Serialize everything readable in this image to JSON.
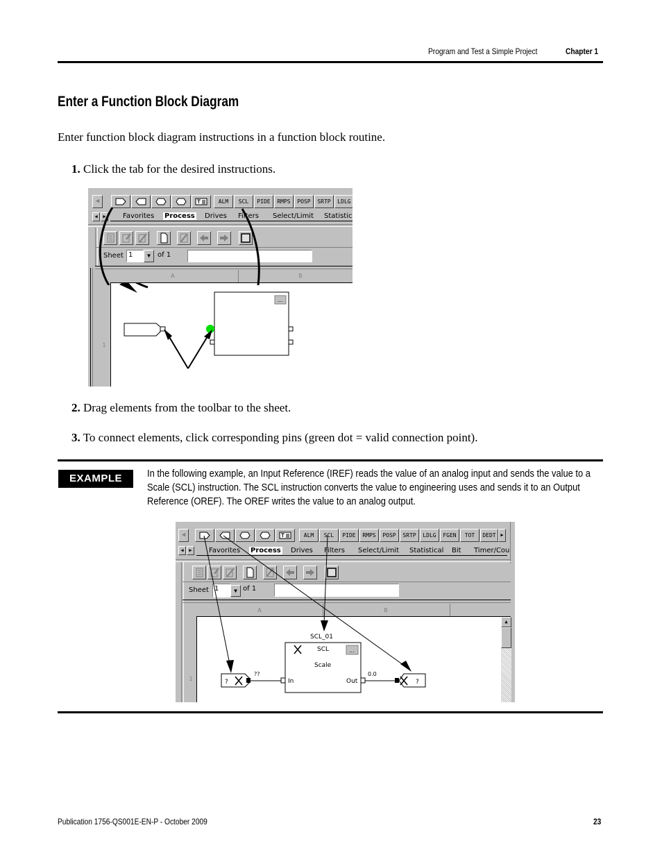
{
  "header": {
    "section_title": "Program and Test a Simple Project",
    "chapter": "Chapter 1"
  },
  "main": {
    "heading": "Enter a Function Block Diagram",
    "intro": "Enter function block diagram instructions in a function block routine.",
    "steps": [
      {
        "num": "1.",
        "text": "Click the tab for the desired instructions."
      },
      {
        "num": "2.",
        "text": "Drag elements from the toolbar to the sheet."
      },
      {
        "num": "3.",
        "text": "To connect elements, click corresponding pins (green dot = valid connection point)."
      }
    ]
  },
  "screenshot1": {
    "element_buttons": [
      "input-reference",
      "output-reference",
      "input-wire-connector",
      "output-wire-connector",
      "text-box"
    ],
    "instruction_buttons": [
      "ALM",
      "SCL",
      "PIDE",
      "RMPS",
      "POSP",
      "SRTP",
      "LDLG"
    ],
    "tabs": [
      "Favorites",
      "Process",
      "Drives",
      "Filters",
      "Select/Limit",
      "Statistica"
    ],
    "active_tab": "Process",
    "sheet_label": "Sheet",
    "sheet_value": "1",
    "sheet_of": "of 1",
    "columns": [
      "A",
      "B"
    ],
    "row": "1",
    "block_button": "...",
    "connection_dot_color": "#00e000"
  },
  "example": {
    "badge": "EXAMPLE",
    "text": "In the following example, an Input Reference (IREF) reads the value of an analog input and sends the value to a Scale (SCL) instruction. The SCL instruction converts the value to engineering uses and sends it to an Output Reference (OREF). The OREF writes the value to an analog output."
  },
  "screenshot2": {
    "element_buttons": [
      "input-reference",
      "output-reference",
      "input-wire-connector",
      "output-wire-connector",
      "text-box"
    ],
    "instruction_buttons": [
      "ALM",
      "SCL",
      "PIDE",
      "RMPS",
      "POSP",
      "SRTP",
      "LDLG",
      "FGEN",
      "TOT",
      "DEDT"
    ],
    "tabs": [
      "Favorites",
      "Process",
      "Drives",
      "Filters",
      "Select/Limit",
      "Statistical",
      "Bit",
      "Timer/Cou"
    ],
    "active_tab": "Process",
    "sheet_label": "Sheet",
    "sheet_value": "1",
    "sheet_of": "of 1",
    "columns": [
      "A",
      "B"
    ],
    "row": "1",
    "block": {
      "tag": "SCL_01",
      "name": "SCL",
      "description": "Scale",
      "input_pin": "In",
      "output_pin": "Out",
      "button": "..."
    },
    "iref_value": "?",
    "iref_wire_value": "??",
    "oref_value": "?",
    "out_wire_value": "0.0"
  },
  "footer": {
    "publication": "Publication 1756-QS001E-EN-P - October 2009",
    "page": "23"
  }
}
